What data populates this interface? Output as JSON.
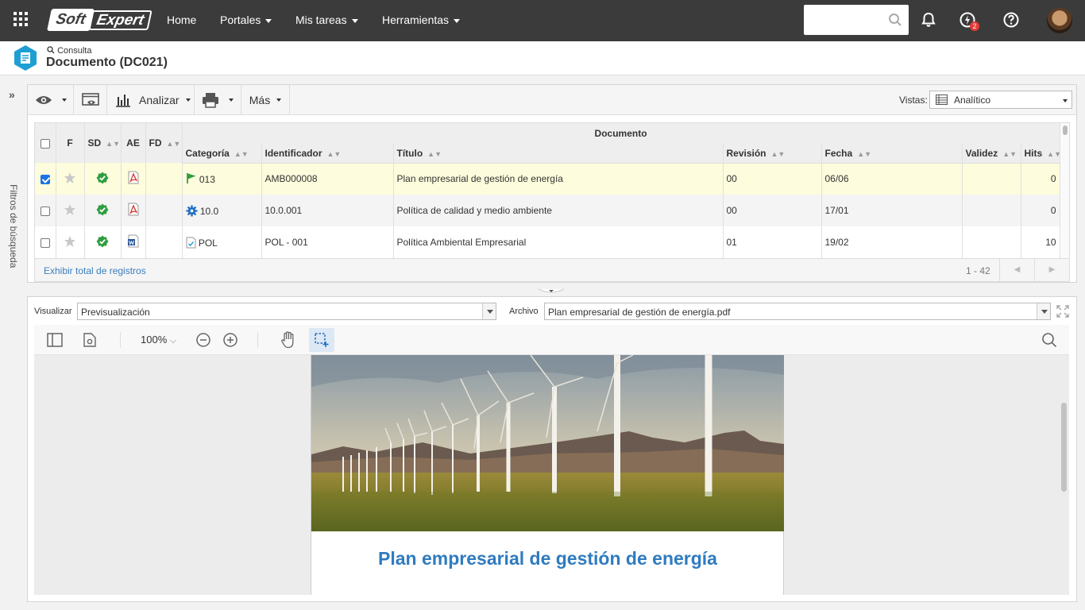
{
  "topbar": {
    "logo_soft": "Soft",
    "logo_expert": "Expert",
    "nav": {
      "home": "Home",
      "portales": "Portales",
      "mis_tareas": "Mis tareas",
      "herramientas": "Herramientas"
    },
    "notification_badge": "2",
    "icons": [
      "apps-grid-icon",
      "search-icon",
      "bell-icon",
      "workflow-icon",
      "help-icon",
      "avatar"
    ]
  },
  "header": {
    "breadcrumb": "Consulta",
    "title": "Documento (DC021)",
    "accent_color": "#1d9fd4"
  },
  "filter_strip": {
    "label": "Filtros de búsqueda"
  },
  "toolbar": {
    "analizar": "Analizar",
    "mas": "Más",
    "vistas_label": "Vistas:",
    "vistas_value": "Analítico"
  },
  "grid": {
    "group_header": "Documento",
    "columns": {
      "f": "F",
      "sd": "SD",
      "ae": "AE",
      "fd": "FD",
      "categoria": "Categoría",
      "identificador": "Identificador",
      "titulo": "Título",
      "revision": "Revisión",
      "fecha": "Fecha",
      "validez": "Validez",
      "hits": "Hits"
    },
    "rows": [
      {
        "selected": true,
        "categoria": "013",
        "categoria_icon": "flag-icon",
        "ae_icon": "pdf-icon",
        "identificador": "AMB000008",
        "titulo": "Plan empresarial de gestión de energía",
        "revision": "00",
        "fecha": "06/06",
        "validez": "",
        "hits": "0"
      },
      {
        "selected": false,
        "categoria": "10.0",
        "categoria_icon": "gear-icon",
        "ae_icon": "pdf-icon",
        "identificador": "10.0.001",
        "titulo": "Política de calidad y medio ambiente",
        "revision": "00",
        "fecha": "17/01",
        "validez": "",
        "hits": "0"
      },
      {
        "selected": false,
        "categoria": "POL",
        "categoria_icon": "checklist-icon",
        "ae_icon": "word-icon",
        "identificador": "POL - 001",
        "titulo": "Política Ambiental Empresarial",
        "revision": "01",
        "fecha": "19/02",
        "validez": "",
        "hits": "10"
      }
    ],
    "footer_total": "Exhibir total de registros",
    "footer_range": "1 - 42"
  },
  "preview": {
    "visualizar_label": "Visualizar",
    "visualizar_value": "Previsualización",
    "archivo_label": "Archivo",
    "archivo_value": "Plan empresarial de gestión de energía.pdf",
    "zoom": "100%",
    "pdf_heading": "Plan empresarial de gestión de energía",
    "heading_color": "#2f7bbf"
  }
}
